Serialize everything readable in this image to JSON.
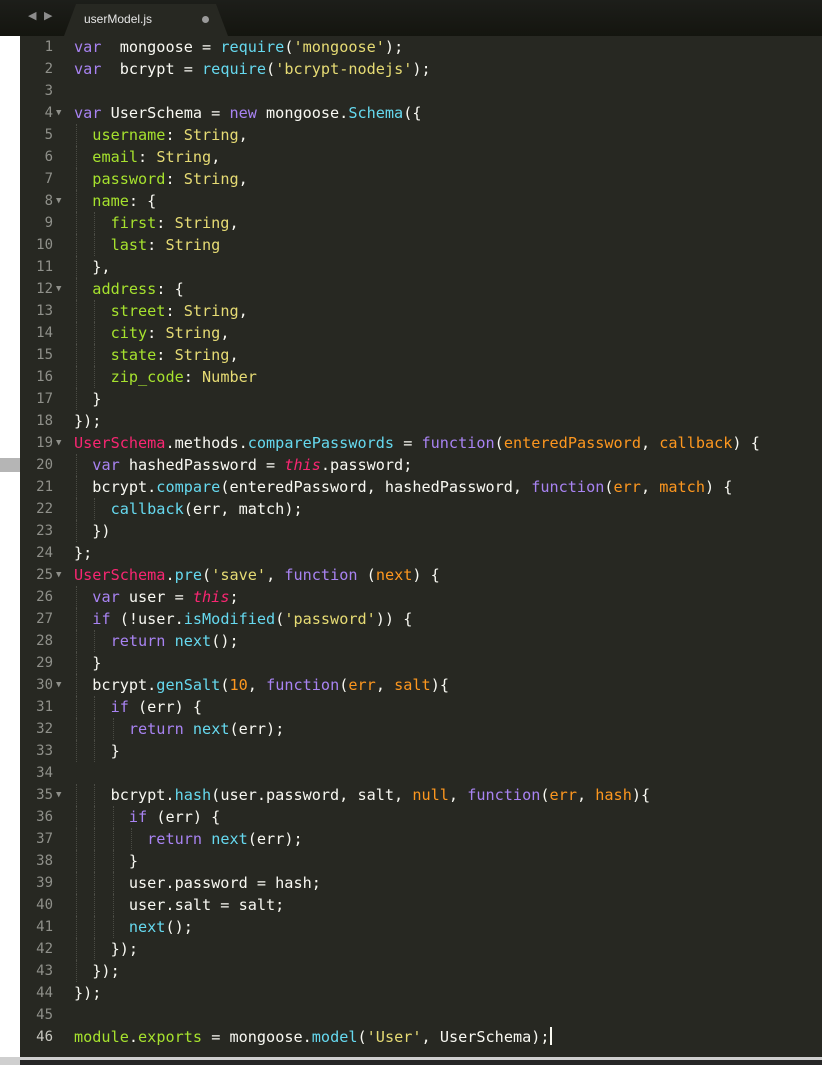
{
  "tab": {
    "title": "userModel.js",
    "modified": true
  },
  "nav": {
    "back": "◀",
    "forward": "▶"
  },
  "lines": [
    {
      "n": "1",
      "fold": false,
      "tokens": [
        [
          "kw",
          "var"
        ],
        [
          "",
          "  mongoose = "
        ],
        [
          "fn",
          "require"
        ],
        [
          "",
          "("
        ],
        [
          "str",
          "'mongoose'"
        ],
        [
          "",
          ");"
        ]
      ]
    },
    {
      "n": "2",
      "fold": false,
      "tokens": [
        [
          "kw",
          "var"
        ],
        [
          "",
          "  bcrypt = "
        ],
        [
          "fn",
          "require"
        ],
        [
          "",
          "("
        ],
        [
          "str",
          "'bcrypt-nodejs'"
        ],
        [
          "",
          ");"
        ]
      ]
    },
    {
      "n": "3",
      "fold": false,
      "tokens": []
    },
    {
      "n": "4",
      "fold": true,
      "tokens": [
        [
          "kw",
          "var"
        ],
        [
          "",
          " UserSchema = "
        ],
        [
          "kw",
          "new"
        ],
        [
          "",
          " mongoose."
        ],
        [
          "fn",
          "Schema"
        ],
        [
          "",
          "({"
        ]
      ]
    },
    {
      "n": "5",
      "fold": false,
      "tokens": [
        [
          "",
          "  "
        ],
        [
          "prop",
          "username"
        ],
        [
          "",
          ": "
        ],
        [
          "str",
          "String"
        ],
        [
          "",
          ","
        ]
      ]
    },
    {
      "n": "6",
      "fold": false,
      "tokens": [
        [
          "",
          "  "
        ],
        [
          "prop",
          "email"
        ],
        [
          "",
          ": "
        ],
        [
          "str",
          "String"
        ],
        [
          "",
          ","
        ]
      ]
    },
    {
      "n": "7",
      "fold": false,
      "tokens": [
        [
          "",
          "  "
        ],
        [
          "prop",
          "password"
        ],
        [
          "",
          ": "
        ],
        [
          "str",
          "String"
        ],
        [
          "",
          ","
        ]
      ]
    },
    {
      "n": "8",
      "fold": true,
      "tokens": [
        [
          "",
          "  "
        ],
        [
          "prop",
          "name"
        ],
        [
          "",
          ": {"
        ]
      ]
    },
    {
      "n": "9",
      "fold": false,
      "tokens": [
        [
          "",
          "    "
        ],
        [
          "prop",
          "first"
        ],
        [
          "",
          ": "
        ],
        [
          "str",
          "String"
        ],
        [
          "",
          ","
        ]
      ]
    },
    {
      "n": "10",
      "fold": false,
      "tokens": [
        [
          "",
          "    "
        ],
        [
          "prop",
          "last"
        ],
        [
          "",
          ": "
        ],
        [
          "str",
          "String"
        ]
      ]
    },
    {
      "n": "11",
      "fold": false,
      "tokens": [
        [
          "",
          "  },"
        ]
      ]
    },
    {
      "n": "12",
      "fold": true,
      "tokens": [
        [
          "",
          "  "
        ],
        [
          "prop",
          "address"
        ],
        [
          "",
          ": {"
        ]
      ]
    },
    {
      "n": "13",
      "fold": false,
      "tokens": [
        [
          "",
          "    "
        ],
        [
          "prop",
          "street"
        ],
        [
          "",
          ": "
        ],
        [
          "str",
          "String"
        ],
        [
          "",
          ","
        ]
      ]
    },
    {
      "n": "14",
      "fold": false,
      "tokens": [
        [
          "",
          "    "
        ],
        [
          "prop",
          "city"
        ],
        [
          "",
          ": "
        ],
        [
          "str",
          "String"
        ],
        [
          "",
          ","
        ]
      ]
    },
    {
      "n": "15",
      "fold": false,
      "tokens": [
        [
          "",
          "    "
        ],
        [
          "prop",
          "state"
        ],
        [
          "",
          ": "
        ],
        [
          "str",
          "String"
        ],
        [
          "",
          ","
        ]
      ]
    },
    {
      "n": "16",
      "fold": false,
      "tokens": [
        [
          "",
          "    "
        ],
        [
          "prop",
          "zip_code"
        ],
        [
          "",
          ": "
        ],
        [
          "str",
          "Number"
        ]
      ]
    },
    {
      "n": "17",
      "fold": false,
      "tokens": [
        [
          "",
          "  }"
        ]
      ]
    },
    {
      "n": "18",
      "fold": false,
      "tokens": [
        [
          "",
          "});"
        ]
      ]
    },
    {
      "n": "19",
      "fold": true,
      "tokens": [
        [
          "cls",
          "UserSchema"
        ],
        [
          "",
          "."
        ],
        [
          "",
          "methods."
        ],
        [
          "fn",
          "comparePasswords"
        ],
        [
          "",
          " = "
        ],
        [
          "kw",
          "function"
        ],
        [
          "",
          "("
        ],
        [
          "param",
          "enteredPassword"
        ],
        [
          "",
          ", "
        ],
        [
          "param",
          "callback"
        ],
        [
          "",
          ") {"
        ]
      ]
    },
    {
      "n": "20",
      "fold": false,
      "tokens": [
        [
          "",
          "  "
        ],
        [
          "kw",
          "var"
        ],
        [
          "",
          " hashedPassword = "
        ],
        [
          "this",
          "this"
        ],
        [
          "",
          ".password;"
        ]
      ]
    },
    {
      "n": "21",
      "fold": false,
      "tokens": [
        [
          "",
          "  bcrypt."
        ],
        [
          "fn",
          "compare"
        ],
        [
          "",
          "(enteredPassword, hashedPassword, "
        ],
        [
          "kw",
          "function"
        ],
        [
          "",
          "("
        ],
        [
          "param",
          "err"
        ],
        [
          "",
          ", "
        ],
        [
          "param",
          "match"
        ],
        [
          "",
          ") {"
        ]
      ]
    },
    {
      "n": "22",
      "fold": false,
      "tokens": [
        [
          "",
          "    "
        ],
        [
          "fn",
          "callback"
        ],
        [
          "",
          "(err, match);"
        ]
      ]
    },
    {
      "n": "23",
      "fold": false,
      "tokens": [
        [
          "",
          "  })"
        ]
      ]
    },
    {
      "n": "24",
      "fold": false,
      "tokens": [
        [
          "",
          "};"
        ]
      ]
    },
    {
      "n": "25",
      "fold": true,
      "tokens": [
        [
          "cls",
          "UserSchema"
        ],
        [
          "",
          "."
        ],
        [
          "fn",
          "pre"
        ],
        [
          "",
          "("
        ],
        [
          "str",
          "'save'"
        ],
        [
          "",
          ", "
        ],
        [
          "kw",
          "function"
        ],
        [
          "",
          " ("
        ],
        [
          "param",
          "next"
        ],
        [
          "",
          ") {"
        ]
      ]
    },
    {
      "n": "26",
      "fold": false,
      "tokens": [
        [
          "",
          "  "
        ],
        [
          "kw",
          "var"
        ],
        [
          "",
          " user = "
        ],
        [
          "this",
          "this"
        ],
        [
          "",
          ";"
        ]
      ]
    },
    {
      "n": "27",
      "fold": false,
      "tokens": [
        [
          "",
          "  "
        ],
        [
          "kw",
          "if"
        ],
        [
          "",
          " (!user."
        ],
        [
          "fn",
          "isModified"
        ],
        [
          "",
          "("
        ],
        [
          "str",
          "'password'"
        ],
        [
          "",
          ")) {"
        ]
      ]
    },
    {
      "n": "28",
      "fold": false,
      "tokens": [
        [
          "",
          "    "
        ],
        [
          "kw",
          "return"
        ],
        [
          "",
          " "
        ],
        [
          "fn",
          "next"
        ],
        [
          "",
          "();"
        ]
      ]
    },
    {
      "n": "29",
      "fold": false,
      "tokens": [
        [
          "",
          "  }"
        ]
      ]
    },
    {
      "n": "30",
      "fold": true,
      "tokens": [
        [
          "",
          "  bcrypt."
        ],
        [
          "fn",
          "genSalt"
        ],
        [
          "",
          "("
        ],
        [
          "param",
          "10"
        ],
        [
          "",
          ", "
        ],
        [
          "kw",
          "function"
        ],
        [
          "",
          "("
        ],
        [
          "param",
          "err"
        ],
        [
          "",
          ", "
        ],
        [
          "param",
          "salt"
        ],
        [
          "",
          "){"
        ]
      ]
    },
    {
      "n": "31",
      "fold": false,
      "tokens": [
        [
          "",
          "    "
        ],
        [
          "kw",
          "if"
        ],
        [
          "",
          " (err) {"
        ]
      ]
    },
    {
      "n": "32",
      "fold": false,
      "tokens": [
        [
          "",
          "      "
        ],
        [
          "kw",
          "return"
        ],
        [
          "",
          " "
        ],
        [
          "fn",
          "next"
        ],
        [
          "",
          "(err);"
        ]
      ]
    },
    {
      "n": "33",
      "fold": false,
      "tokens": [
        [
          "",
          "    }"
        ]
      ]
    },
    {
      "n": "34",
      "fold": false,
      "tokens": []
    },
    {
      "n": "35",
      "fold": true,
      "tokens": [
        [
          "",
          "    bcrypt."
        ],
        [
          "fn",
          "hash"
        ],
        [
          "",
          "(user.password, salt, "
        ],
        [
          "param",
          "null"
        ],
        [
          "",
          ", "
        ],
        [
          "kw",
          "function"
        ],
        [
          "",
          "("
        ],
        [
          "param",
          "err"
        ],
        [
          "",
          ", "
        ],
        [
          "param",
          "hash"
        ],
        [
          "",
          "){"
        ]
      ]
    },
    {
      "n": "36",
      "fold": false,
      "tokens": [
        [
          "",
          "      "
        ],
        [
          "kw",
          "if"
        ],
        [
          "",
          " (err) {"
        ]
      ]
    },
    {
      "n": "37",
      "fold": false,
      "tokens": [
        [
          "",
          "        "
        ],
        [
          "kw",
          "return"
        ],
        [
          "",
          " "
        ],
        [
          "fn",
          "next"
        ],
        [
          "",
          "(err);"
        ]
      ]
    },
    {
      "n": "38",
      "fold": false,
      "tokens": [
        [
          "",
          "      }"
        ]
      ]
    },
    {
      "n": "39",
      "fold": false,
      "tokens": [
        [
          "",
          "      user.password = hash;"
        ]
      ]
    },
    {
      "n": "40",
      "fold": false,
      "tokens": [
        [
          "",
          "      user.salt = salt;"
        ]
      ]
    },
    {
      "n": "41",
      "fold": false,
      "tokens": [
        [
          "",
          "      "
        ],
        [
          "fn",
          "next"
        ],
        [
          "",
          "();"
        ]
      ]
    },
    {
      "n": "42",
      "fold": false,
      "tokens": [
        [
          "",
          "    });"
        ]
      ]
    },
    {
      "n": "43",
      "fold": false,
      "tokens": [
        [
          "",
          "  });"
        ]
      ]
    },
    {
      "n": "44",
      "fold": false,
      "tokens": [
        [
          "",
          "});"
        ]
      ]
    },
    {
      "n": "45",
      "fold": false,
      "tokens": []
    },
    {
      "n": "46",
      "fold": false,
      "current": true,
      "tokens": [
        [
          "prop",
          "module"
        ],
        [
          "",
          "."
        ],
        [
          "prop",
          "exports"
        ],
        [
          "",
          " = mongoose."
        ],
        [
          "fn",
          "model"
        ],
        [
          "",
          "("
        ],
        [
          "str",
          "'User'"
        ],
        [
          "",
          ", UserSchema);"
        ]
      ]
    }
  ]
}
